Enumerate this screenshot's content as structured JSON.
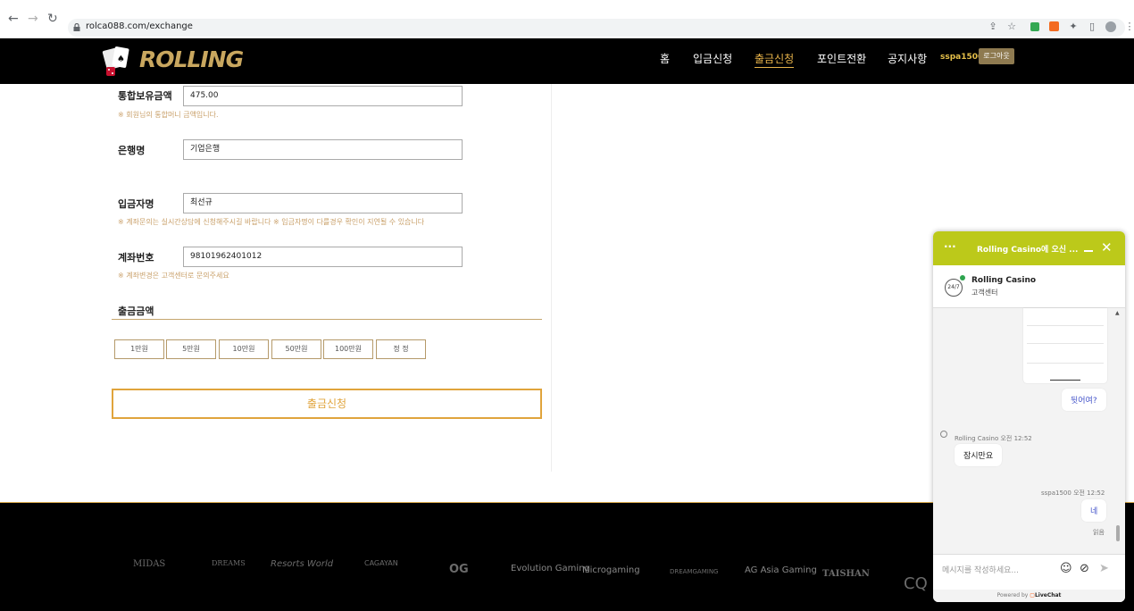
{
  "browser": {
    "url": "rolca088.com/exchange"
  },
  "header": {
    "logo_text": "ROLLING",
    "nav": [
      "홈",
      "입금신청",
      "출금신청",
      "포인트전환",
      "공지사항"
    ],
    "username": "sspa1500",
    "logout_label": "로그아웃"
  },
  "form": {
    "balance": {
      "label": "통합보유금액",
      "value": "475.00",
      "hint": "※ 회원님의 통합머니 금액입니다."
    },
    "bank": {
      "label": "은행명",
      "value": "기업은행"
    },
    "depositor": {
      "label": "입금자명",
      "value": "최선규",
      "hint": "※ 계좌문의는 실시간상담에 신청해주시길 바랍니다 ※ 입금자명이 다를경우 확인이 지연될 수 있습니다"
    },
    "account": {
      "label": "계좌번호",
      "value": "98101962401012",
      "hint": "※ 계좌변경은 고객센터로 문의주세요"
    },
    "amount_title": "출금금액",
    "amount_buttons": [
      "1만원",
      "5만원",
      "10만원",
      "50만원",
      "100만원",
      "정 정"
    ],
    "submit_label": "출금신청"
  },
  "footer": {
    "providers": [
      "MIDAS",
      "DREAMS",
      "Resorts World",
      "CAGAYAN",
      "OG",
      "Evolution Gaming",
      "Microgaming",
      "DREAMGAMING",
      "AG Asia Gaming",
      "TAISHAN",
      "CQ"
    ]
  },
  "chat": {
    "title": "Rolling Casino에 오신 ...",
    "agent_name": "Rolling Casino",
    "agent_sub": "고객센터",
    "badge": "24/7",
    "messages": [
      {
        "from": "user",
        "text": "뒷어여?"
      },
      {
        "from": "agent",
        "sender": "Rolling Casino 오전 12:52",
        "text": "잠시만요"
      },
      {
        "from": "user",
        "sender": "sspa1500 오전 12:52",
        "text": "네",
        "status": "읽음"
      }
    ],
    "placeholder": "메시지를 작성하세요...",
    "powered": "Powered by",
    "powered_brand": "LiveChat"
  },
  "colors": {
    "accent": "#e0a43c",
    "chat_green": "#bcc91a",
    "gold": "#c9a75f"
  }
}
